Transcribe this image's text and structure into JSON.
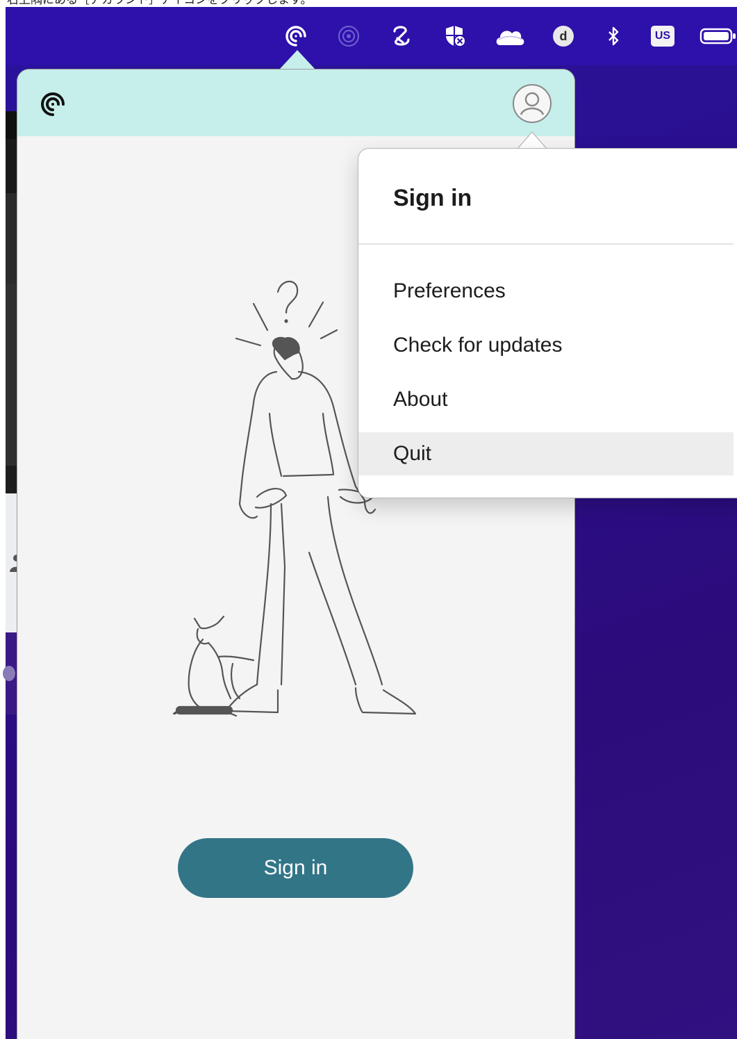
{
  "caption": {
    "text": "右上隅にある［アカウント］アイコンをクリックします。"
  },
  "menubar": {
    "status_icons": [
      "citrix-workspace-icon",
      "airplay-icon",
      "link-icon",
      "shield-x-icon",
      "cloud-icon",
      "d-badge-icon",
      "bluetooth-icon",
      "keyboard-layout-icon",
      "battery-icon"
    ],
    "d_badge": "d",
    "keyboard_layout": "US"
  },
  "panel": {
    "signin_button_label": "Sign in"
  },
  "account_menu": {
    "title": "Sign in",
    "items": [
      {
        "label": "Preferences"
      },
      {
        "label": "Check for updates"
      },
      {
        "label": "About"
      },
      {
        "label": "Quit"
      }
    ],
    "highlighted_item": "Quit"
  },
  "colors": {
    "menubar": "#2e10aa",
    "panel_header": "#c6eeea",
    "signin_button": "#327587",
    "desktop": "#2a0f8c"
  }
}
